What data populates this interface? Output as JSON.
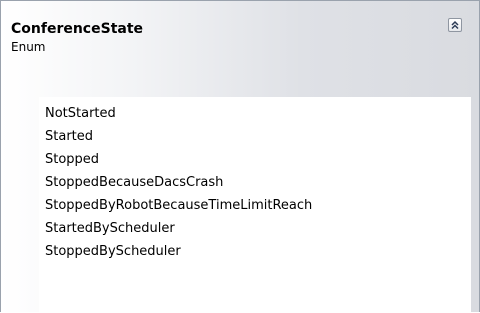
{
  "shape": {
    "title": "ConferenceState",
    "subtitle": "Enum",
    "collapse_icon": "double-chevron-up-icon"
  },
  "members": [
    {
      "label": "NotStarted"
    },
    {
      "label": "Started"
    },
    {
      "label": "Stopped"
    },
    {
      "label": "StoppedBecauseDacsCrash"
    },
    {
      "label": "StoppedByRobotBecauseTimeLimitReach"
    },
    {
      "label": "StartedByScheduler"
    },
    {
      "label": "StoppedByScheduler"
    }
  ]
}
